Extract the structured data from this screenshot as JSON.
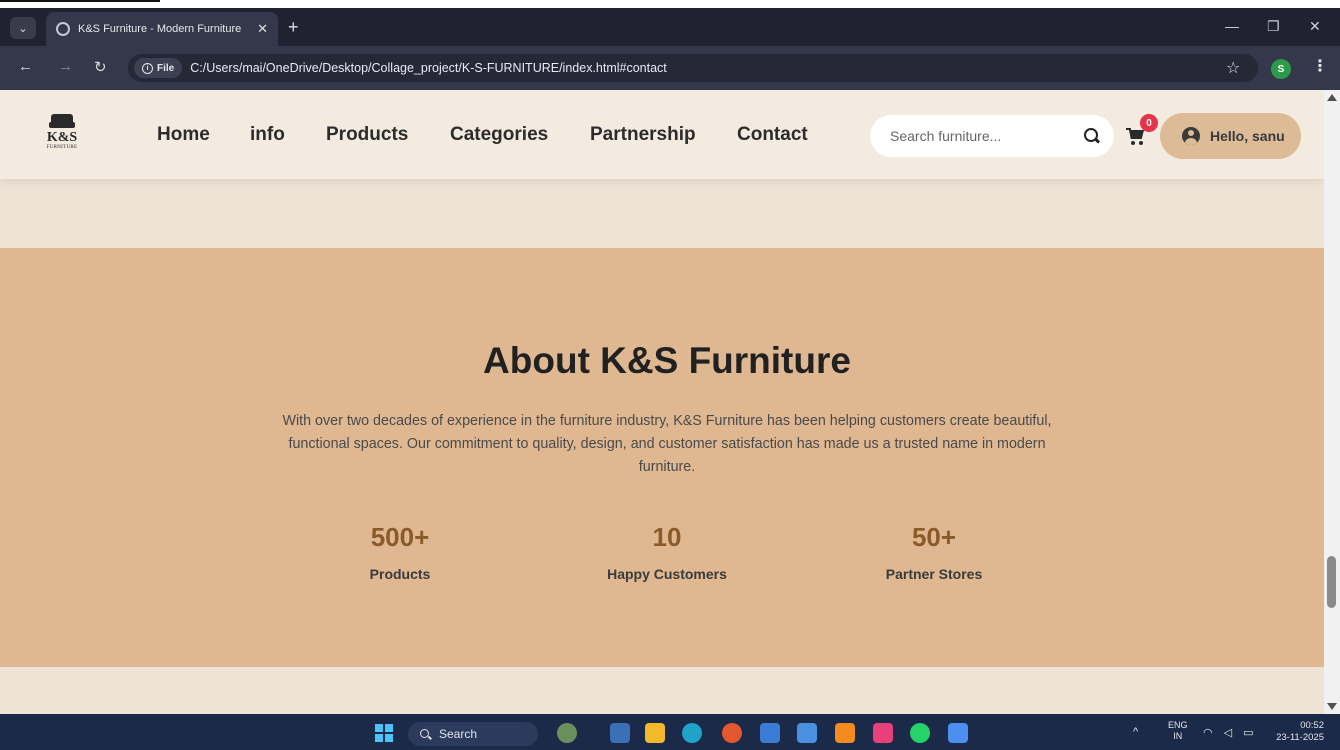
{
  "browser": {
    "tab_title": "K&S Furniture - Modern Furniture",
    "tab_close": "✕",
    "new_tab": "+",
    "file_chip": "File",
    "url": "C:/Users/mai/OneDrive/Desktop/Collage_project/K-S-FURNITURE/index.html#contact",
    "profile_initial": "S"
  },
  "header": {
    "logo_name": "K&S",
    "logo_sub": "FURNITURE",
    "nav": [
      "Home",
      "info",
      "Products",
      "Categories",
      "Partnership",
      "Contact"
    ],
    "search_placeholder": "Search furniture...",
    "cart_count": "0",
    "greeting": "Hello, sanu"
  },
  "about": {
    "title": "About K&S Furniture",
    "text": "With over two decades of experience in the furniture industry, K&S Furniture has been helping customers create beautiful, functional spaces. Our commitment to quality, design, and customer satisfaction has made us a trusted name in modern furniture.",
    "stats": [
      {
        "number": "500+",
        "label": "Products"
      },
      {
        "number": "10",
        "label": "Happy Customers"
      },
      {
        "number": "50+",
        "label": "Partner Stores"
      }
    ]
  },
  "taskbar": {
    "search_label": "Search",
    "lang_line1": "ENG",
    "lang_line2": "IN",
    "time": "00:52",
    "date": "23-11-2025"
  },
  "colors": {
    "page_bg": "#efe3d6",
    "about_bg": "#dfb892",
    "stat_number": "#8b5a2b",
    "user_button": "#dcbb97",
    "cart_badge": "#e5334b"
  }
}
